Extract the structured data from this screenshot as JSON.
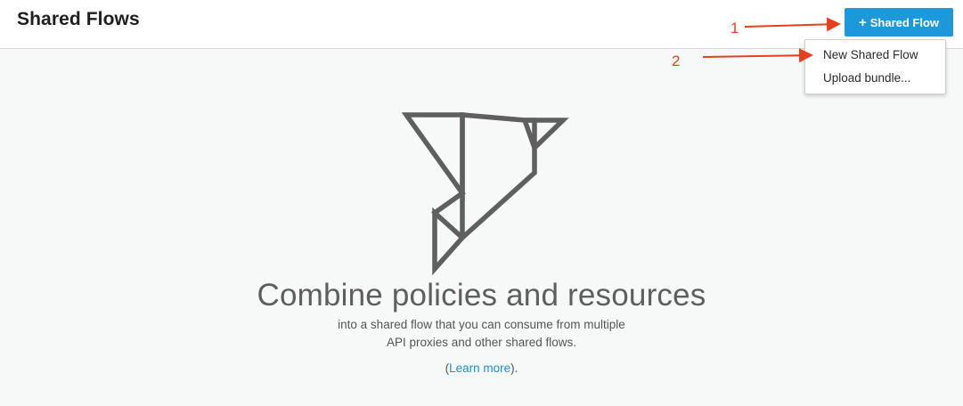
{
  "header": {
    "title": "Shared Flows",
    "add_button": {
      "icon": "plus-icon",
      "label": "Shared Flow"
    }
  },
  "dropdown": {
    "items": [
      {
        "label": "New Shared Flow"
      },
      {
        "label": "Upload bundle..."
      }
    ]
  },
  "annotations": {
    "step1": "1",
    "step2": "2",
    "arrow_color": "#e8401c"
  },
  "empty_state": {
    "illustration": "origami-bird-icon",
    "headline": "Combine policies and resources",
    "description_line1": "into a shared flow that you can consume from multiple",
    "description_line2": "API proxies and other shared flows.",
    "learn_more_prefix": "(",
    "learn_more_link": "Learn more",
    "learn_more_suffix": ")."
  },
  "colors": {
    "primary_button": "#1d98d8",
    "link": "#1d8fce",
    "illustration": "#5f5f5f"
  }
}
